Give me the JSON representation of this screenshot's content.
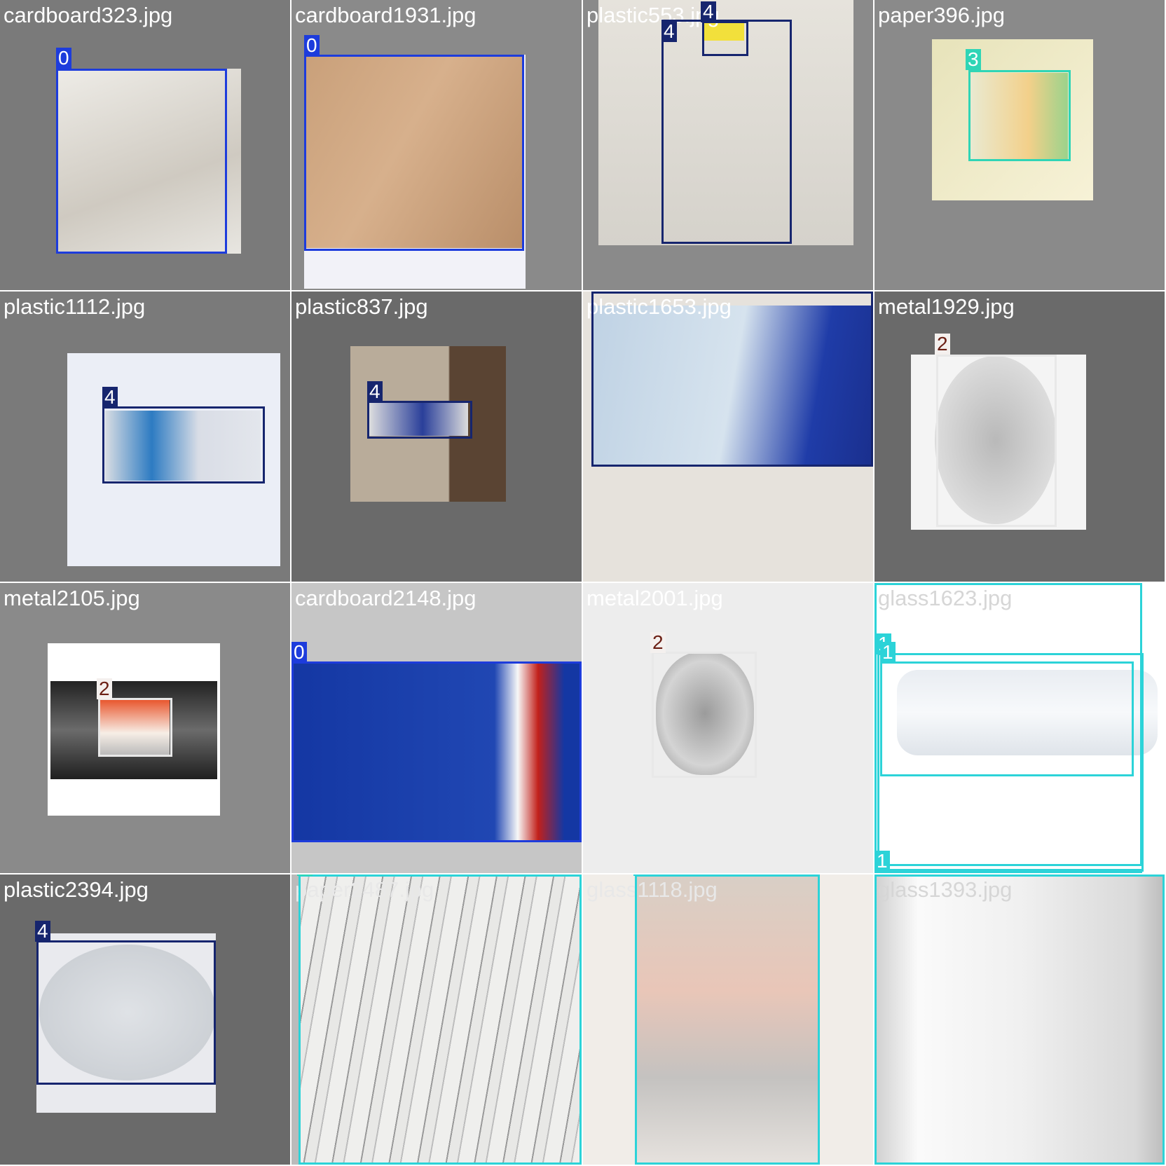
{
  "class_labels": {
    "0": "0",
    "1": "1",
    "2": "2",
    "3": "3",
    "4": "4"
  },
  "class_colors": {
    "0": "#1d3cdc",
    "1": "#2cd3d8",
    "2": "#e8e8e8",
    "3": "#2fd5b6",
    "4": "#16256e"
  },
  "tiles": [
    {
      "filename": "cardboard323.jpg",
      "boxes": [
        "0"
      ]
    },
    {
      "filename": "cardboard1931.jpg",
      "boxes": [
        "0"
      ]
    },
    {
      "filename": "plastic553.jpg",
      "boxes": [
        "4",
        "4"
      ]
    },
    {
      "filename": "paper396.jpg",
      "boxes": [
        "3"
      ]
    },
    {
      "filename": "plastic1112.jpg",
      "boxes": [
        "4"
      ]
    },
    {
      "filename": "plastic837.jpg",
      "boxes": [
        "4"
      ]
    },
    {
      "filename": "plastic1653.jpg",
      "boxes": [
        "4"
      ]
    },
    {
      "filename": "metal1929.jpg",
      "boxes": [
        "2"
      ]
    },
    {
      "filename": "metal2105.jpg",
      "boxes": [
        "2"
      ]
    },
    {
      "filename": "cardboard2148.jpg",
      "boxes": [
        "0"
      ]
    },
    {
      "filename": "metal2001.jpg",
      "boxes": [
        "2"
      ]
    },
    {
      "filename": "glass1623.jpg",
      "boxes": [
        "1",
        "1",
        "1",
        "1"
      ]
    },
    {
      "filename": "plastic2394.jpg",
      "boxes": [
        "4"
      ]
    },
    {
      "filename": "paper2487.jpg",
      "boxes": [
        "3"
      ]
    },
    {
      "filename": "glass1118.jpg",
      "boxes": [
        "1"
      ]
    },
    {
      "filename": "glass1393.jpg",
      "boxes": [
        "1"
      ]
    }
  ]
}
